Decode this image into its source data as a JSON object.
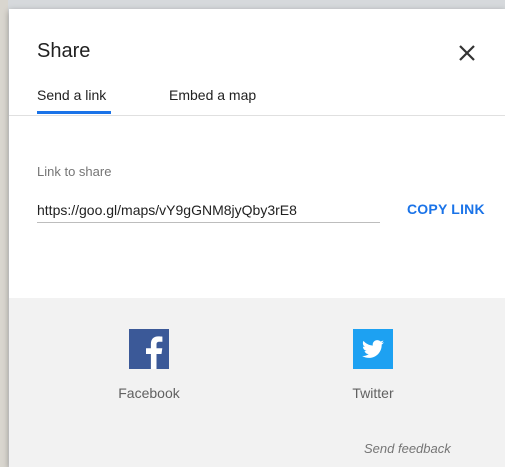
{
  "dialog": {
    "title": "Share",
    "close_icon": "close-icon"
  },
  "tabs": [
    {
      "label": "Send a link",
      "active": true
    },
    {
      "label": "Embed a map",
      "active": false
    }
  ],
  "link": {
    "label": "Link to share",
    "value": "https://goo.gl/maps/vY9gGNM8jyQby3rE8",
    "copy_label": "COPY LINK"
  },
  "social": [
    {
      "name": "Facebook",
      "icon": "facebook-icon",
      "color": "#3b5998"
    },
    {
      "name": "Twitter",
      "icon": "twitter-icon",
      "color": "#1da1f2"
    }
  ],
  "footer": {
    "feedback_label": "Send feedback"
  },
  "colors": {
    "accent": "#1a73e8",
    "facebook": "#3b5998",
    "twitter": "#1da1f2"
  }
}
